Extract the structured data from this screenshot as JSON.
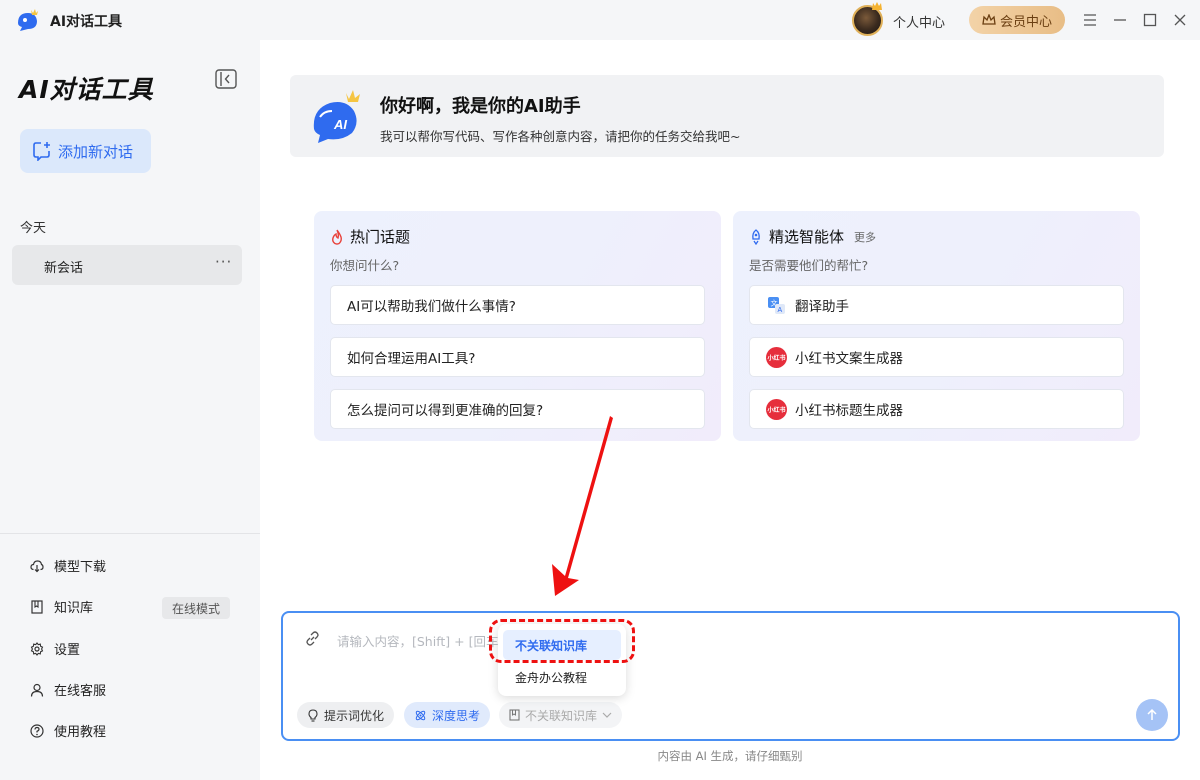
{
  "titlebar": {
    "app_title": "AI对话工具",
    "user_center": "个人中心",
    "member_center": "会员中心"
  },
  "sidebar": {
    "title": "AI对话工具",
    "new_chat": "添加新对话",
    "today": "今天",
    "session": "新会话",
    "session_more": "···",
    "nav": [
      {
        "label": "模型下载",
        "icon": "cloud-download-icon"
      },
      {
        "label": "知识库",
        "icon": "book-icon"
      },
      {
        "label": "设置",
        "icon": "gear-icon"
      },
      {
        "label": "在线客服",
        "icon": "person-icon"
      },
      {
        "label": "使用教程",
        "icon": "help-icon"
      }
    ],
    "online_mode": "在线模式"
  },
  "hero": {
    "title": "你好啊，我是你的AI助手",
    "subtitle": "我可以帮你写代码、写作各种创意内容，请把你的任务交给我吧~"
  },
  "hot_topics": {
    "title": "热门话题",
    "subtitle": "你想问什么?",
    "items": [
      "AI可以帮助我们做什么事情?",
      "如何合理运用AI工具?",
      "怎么提问可以得到更准确的回复?"
    ]
  },
  "agents": {
    "title": "精选智能体",
    "more": "更多",
    "subtitle": "是否需要他们的帮忙?",
    "items": [
      {
        "label": "翻译助手",
        "icon": "translate-icon"
      },
      {
        "label": "小红书文案生成器",
        "icon": "xiaohongshu-icon",
        "badge": "小红书"
      },
      {
        "label": "小红书标题生成器",
        "icon": "xiaohongshu-icon",
        "badge": "小红书"
      }
    ]
  },
  "input": {
    "placeholder": "请输入内容，[Shift] + [回车]",
    "prompt_opt": "提示词优化",
    "deep_think": "深度思考",
    "kb_select": "不关联知识库"
  },
  "dropdown": {
    "options": [
      "不关联知识库",
      "金舟办公教程"
    ],
    "selected": "不关联知识库"
  },
  "footer_note": "内容由 AI 生成，请仔细甄别",
  "colors": {
    "accent": "#2f6bef",
    "input_border": "#4a8ff3",
    "annotation_red": "#ee1111"
  }
}
